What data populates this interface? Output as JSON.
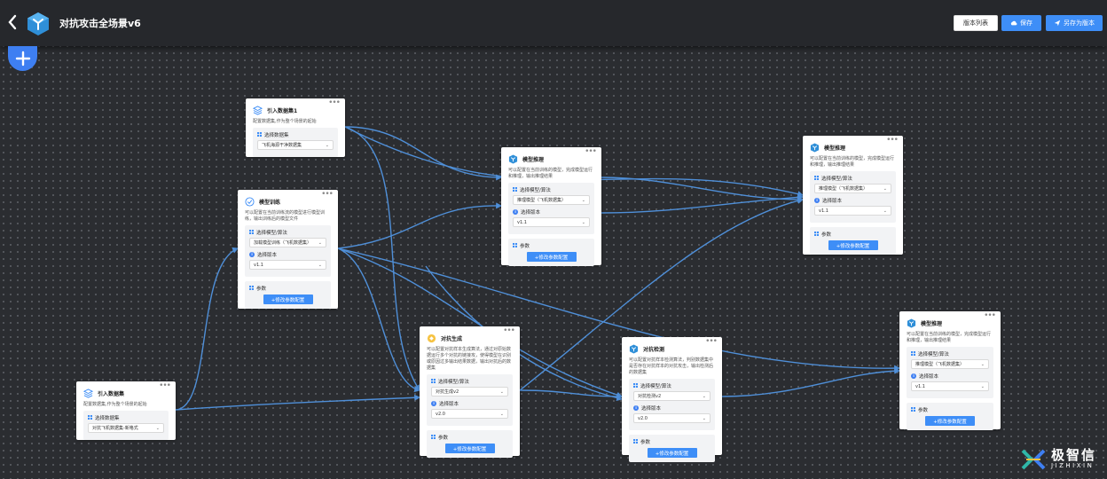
{
  "header": {
    "title": "对抗攻击全场景v6",
    "buttons": {
      "version_list": "版本列表",
      "save": "保存",
      "save_as_version": "另存为版本"
    }
  },
  "colors": {
    "accent": "#3e8ef7",
    "edge": "#4f8fd8",
    "canvas": "#2b2d31"
  },
  "nodes": {
    "import1": {
      "title": "引入数据集1",
      "desc": "配置数据集,作为整个场景的起始",
      "select_label": "选择数据集",
      "select_value": "飞机海源干净数据集"
    },
    "import2": {
      "title": "引入数据集",
      "desc": "配置数据集,作为整个场景的起始",
      "select_label": "选择数据集",
      "select_value": "对抗飞机数据集-新格式"
    },
    "train": {
      "title": "模型训练",
      "desc": "可以配置在当前训练流的模型进行模型训练，输出训练后的模型文件",
      "model_label": "选择模型/算法",
      "model_value": "加载模型训练（飞机数据集）",
      "version_label": "选择版本",
      "version_value": "v1.1",
      "params_label": "参数",
      "params_button": "+修改参数配置"
    },
    "infer1": {
      "title": "模型推理",
      "desc": "可以配置在当前训练的模型，完成模型运行和推理，输出推理结果",
      "model_label": "选择模型/算法",
      "model_value": "推理模型（飞机数据集）",
      "version_label": "选择版本",
      "version_value": "v1.1",
      "params_label": "参数",
      "params_button": "+修改参数配置"
    },
    "infer2": {
      "title": "模型推理",
      "desc": "可以配置在当前训练的模型，完成模型运行和推理，输出推理结果",
      "model_label": "选择模型/算法",
      "model_value": "推理模型（飞机数据集）",
      "version_label": "选择版本",
      "version_value": "v1.1",
      "params_label": "参数",
      "params_button": "+修改参数配置"
    },
    "infer3": {
      "title": "模型推理",
      "desc": "可以配置在当前训练的模型，完成模型运行和推理，输出推理结果",
      "model_label": "选择模型/算法",
      "model_value": "推理模型（飞机数据集）",
      "version_label": "选择版本",
      "version_value": "v1.1",
      "params_label": "参数",
      "params_button": "+修改参数配置"
    },
    "adv_gen": {
      "title": "对抗生成",
      "desc": "可以配置对抗样本生成算法，通过对原始数据运行多个对抗的链接攻，使得模型在识别或原因过多输出结果数据，输出对抗后的数据集",
      "model_label": "选择模型/算法",
      "model_value": "对抗生成v2",
      "version_label": "选择版本",
      "version_value": "v2.0",
      "params_label": "参数",
      "params_button": "+修改参数配置"
    },
    "adv_det": {
      "title": "对抗检测",
      "desc": "可以配置对抗样本检测算法，判别数据集中是否存在对抗样本的对抗攻击，输出检测后的数据集",
      "model_label": "选择模型/算法",
      "model_value": "对抗检测v2",
      "version_label": "选择版本",
      "version_value": "v2.0",
      "params_label": "参数",
      "params_button": "+修改参数配置"
    }
  },
  "watermark": {
    "cn": "极智信",
    "en": "JIZHIXIN"
  }
}
